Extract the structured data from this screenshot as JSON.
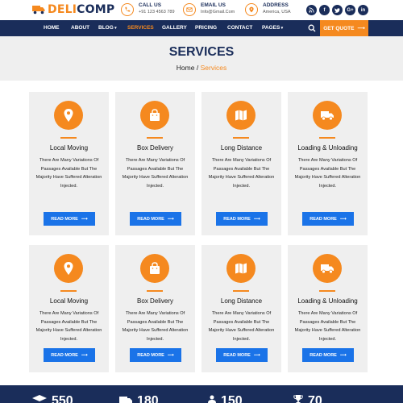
{
  "brand": {
    "part1": "DELI",
    "part2": "COMP"
  },
  "contacts": [
    {
      "title": "CALL US",
      "value": "+91 123 4563 789",
      "icon": "phone-icon"
    },
    {
      "title": "EMAIL US",
      "value": "Info@Gmail.Com",
      "icon": "email-icon"
    },
    {
      "title": "ADDRESS",
      "value": "America, USA",
      "icon": "location-icon"
    }
  ],
  "socials": [
    {
      "label": "rss",
      "icon": "rss-icon"
    },
    {
      "label": "f",
      "icon": "facebook-icon"
    },
    {
      "label": "t",
      "icon": "twitter-icon"
    },
    {
      "label": "G+",
      "icon": "google-plus-icon"
    },
    {
      "label": "in",
      "icon": "linkedin-icon"
    }
  ],
  "nav": {
    "items": [
      "HOME",
      "ABOUT",
      "BLOG",
      "SERVICES",
      "GALLERY",
      "PRICING",
      "CONTACT",
      "PAGES"
    ],
    "active": "SERVICES",
    "quote": "GET QUOTE"
  },
  "hero": {
    "title": "SERVICES",
    "crumb_home": "Home",
    "crumb_sep": "/",
    "crumb_current": "Services"
  },
  "cards": [
    {
      "title": "Local Moving",
      "desc": "There Are Many Variations Of Passages Available But The Majority Have Suffered Alteration Injected.",
      "button": "READ MORE",
      "icon": "location-pin-icon"
    },
    {
      "title": "Box Delivery",
      "desc": "There Are Many Variations Of Passages Available But The Majority Have Suffered Alteration Injected.",
      "button": "READ MORE",
      "icon": "shopping-bag-icon"
    },
    {
      "title": "Long Distance",
      "desc": "There Are Many Variations Of Passages Available But The Majority Have Suffered Alteration Injected.",
      "button": "READ MORE",
      "icon": "map-icon"
    },
    {
      "title": "Loading & Unloading",
      "desc": "There Are Many Variations Of Passages Available But The Majority Have Suffered Alteration Injected.",
      "button": "READ MORE",
      "icon": "truck-icon"
    },
    {
      "title": "Local Moving",
      "desc": "There Are Many Variations Of Passages Available But The Majority Have Suffered Alteration Injected.",
      "button": "READ MORE",
      "icon": "location-pin-icon"
    },
    {
      "title": "Box Delivery",
      "desc": "There Are Many Variations Of Passages Available But The Majority Have Suffered Alteration Injected.",
      "button": "READ MORE",
      "icon": "shopping-bag-icon"
    },
    {
      "title": "Long Distance",
      "desc": "There Are Many Variations Of Passages Available But The Majority Have Suffered Alteration Injected.",
      "button": "READ MORE",
      "icon": "map-icon"
    },
    {
      "title": "Loading & Unloading",
      "desc": "There Are Many Variations Of Passages Available But The Majority Have Suffered Alteration Injected.",
      "button": "READ MORE",
      "icon": "truck-icon"
    }
  ],
  "stats": [
    {
      "value": "550",
      "icon": "graduation-cap-icon"
    },
    {
      "value": "180",
      "icon": "truck-icon"
    },
    {
      "value": "150",
      "icon": "user-icon"
    },
    {
      "value": "70",
      "icon": "trophy-icon"
    }
  ],
  "colors": {
    "accent": "#f5891f",
    "navy": "#1a2d5a",
    "button": "#1a73e8",
    "panel": "#efefef"
  }
}
